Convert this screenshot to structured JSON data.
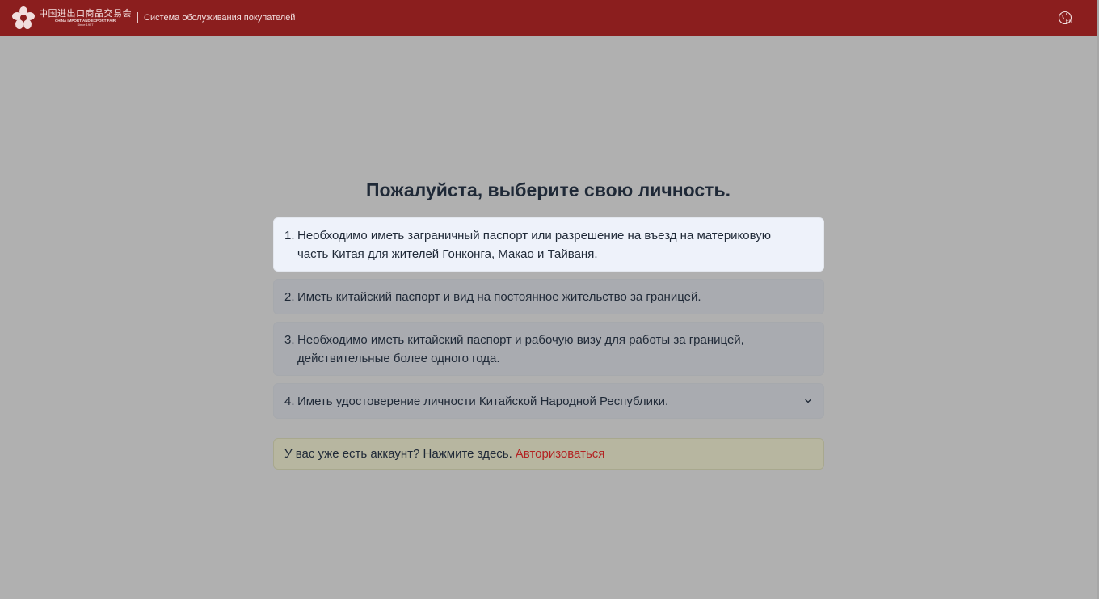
{
  "header": {
    "logo_cn": "中国进出口商品交易会",
    "logo_en": "CHINA IMPORT AND EXPORT FAIR",
    "logo_since": "Since 1957",
    "subtitle": "Система обслуживания покупателей",
    "lang_icon_label": "En"
  },
  "main": {
    "title": "Пожалуйста, выберите свою личность.",
    "options": [
      {
        "num": "1.",
        "text": "Необходимо иметь заграничный паспорт или разрешение на въезд на материковую часть Китая для жителей Гонконга, Макао и Тайваня."
      },
      {
        "num": "2.",
        "text": "Иметь китайский паспорт и вид на постоянное жительство за границей."
      },
      {
        "num": "3.",
        "text": "Необходимо иметь китайский паспорт и рабочую визу для работы за границей, действительные более одного года."
      },
      {
        "num": "4.",
        "text": "Иметь удостоверение личности Китайской Народной Республики."
      }
    ],
    "login_prompt": "У вас уже есть аккаунт? Нажмите здесь.",
    "login_link": "Авторизоваться"
  },
  "colors": {
    "header_bg": "#8b1e1e",
    "overlay_bg": "#b0b0b0",
    "active_option_bg": "#eef2fa",
    "link_red": "#b32222"
  },
  "icons": {
    "logo": "canton-fair-flower-logo",
    "language": "globe-language-icon",
    "expand": "chevron-down-icon"
  }
}
